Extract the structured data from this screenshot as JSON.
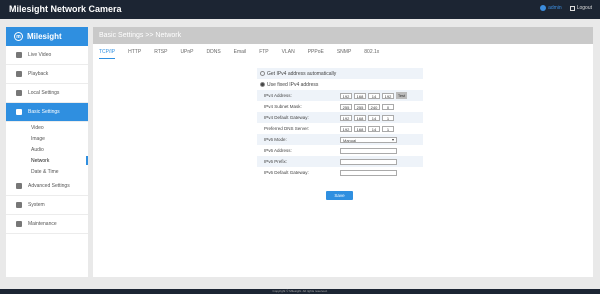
{
  "app": {
    "title": "Milesight Network Camera",
    "user": "admin",
    "logout": "Logout"
  },
  "sidebar": {
    "logo": "Milesight",
    "items": [
      {
        "label": "Live Video",
        "icon": "live-video-icon"
      },
      {
        "label": "Playback",
        "icon": "playback-icon"
      },
      {
        "label": "Local Settings",
        "icon": "local-settings-icon"
      },
      {
        "label": "Basic Settings",
        "icon": "basic-settings-icon"
      }
    ],
    "subitems": [
      "Video",
      "Image",
      "Audio",
      "Network",
      "Date & Time"
    ],
    "items2": [
      {
        "label": "Advanced Settings",
        "icon": "advanced-settings-icon"
      },
      {
        "label": "System",
        "icon": "system-icon"
      },
      {
        "label": "Maintenance",
        "icon": "maintenance-icon"
      }
    ]
  },
  "main": {
    "breadcrumb": "Basic Settings >> Network",
    "tabs": [
      "TCP/IP",
      "HTTP",
      "RTSP",
      "UPnP",
      "DDNS",
      "Email",
      "FTP",
      "VLAN",
      "PPPoE",
      "SNMP",
      "802.1x"
    ]
  },
  "form": {
    "radio_auto": "Get IPv4 address automatically",
    "radio_fixed": "Use fixed IPv4 address",
    "ipv4_address_label": "IPv4 Address:",
    "ipv4_address": [
      "192",
      "168",
      "14",
      "192"
    ],
    "test_label": "Test",
    "subnet_label": "IPv4 Subnet Mask:",
    "subnet": [
      "255",
      "255",
      "240",
      "0"
    ],
    "gateway_label": "IPv4 Default Gateway:",
    "gateway": [
      "192",
      "168",
      "14",
      "1"
    ],
    "dns_label": "Preferred DNS Server:",
    "dns": [
      "192",
      "168",
      "14",
      "1"
    ],
    "ipv6_mode_label": "IPv6 Mode:",
    "ipv6_mode": "Manual",
    "ipv6_address_label": "IPv6 Address:",
    "ipv6_prefix_label": "IPv6 Prefix:",
    "ipv6_gateway_label": "IPv6 Default Gateway:",
    "save_label": "Save"
  },
  "footer": "Copyright © Milesight. All rights reserved."
}
